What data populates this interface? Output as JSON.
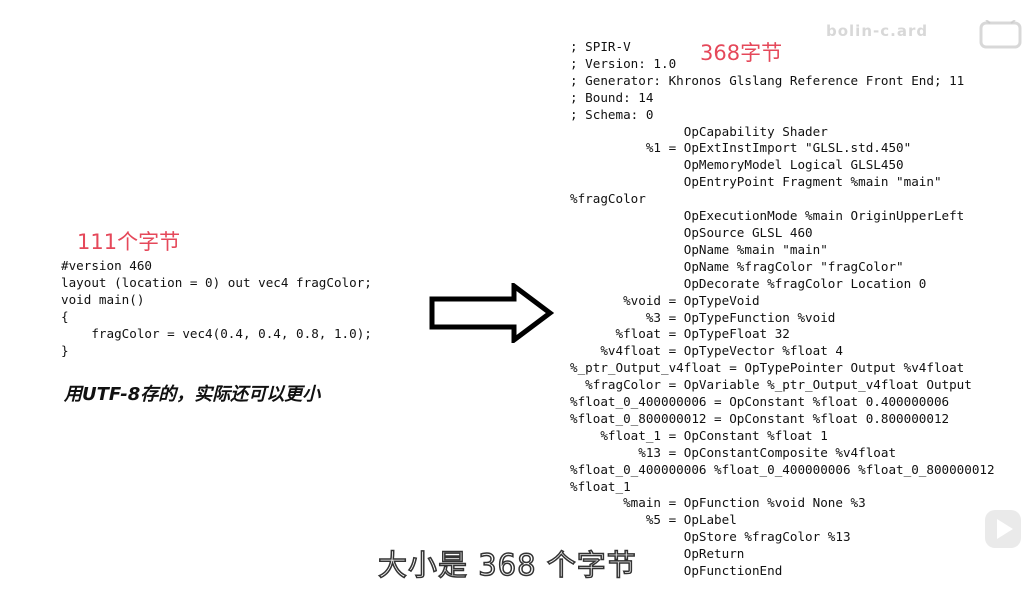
{
  "left": {
    "size_label": "111个字节",
    "code": "#version 460\nlayout (location = 0) out vec4 fragColor;\nvoid main()\n{\n    fragColor = vec4(0.4, 0.4, 0.8, 1.0);\n}",
    "note": "用UTF-8存的，实际还可以更小"
  },
  "right": {
    "size_label": "368字节",
    "code": "; SPIR-V\n; Version: 1.0\n; Generator: Khronos Glslang Reference Front End; 11\n; Bound: 14\n; Schema: 0\n               OpCapability Shader\n          %1 = OpExtInstImport \"GLSL.std.450\"\n               OpMemoryModel Logical GLSL450\n               OpEntryPoint Fragment %main \"main\"\n%fragColor\n               OpExecutionMode %main OriginUpperLeft\n               OpSource GLSL 460\n               OpName %main \"main\"\n               OpName %fragColor \"fragColor\"\n               OpDecorate %fragColor Location 0\n       %void = OpTypeVoid\n          %3 = OpTypeFunction %void\n      %float = OpTypeFloat 32\n    %v4float = OpTypeVector %float 4\n%_ptr_Output_v4float = OpTypePointer Output %v4float\n  %fragColor = OpVariable %_ptr_Output_v4float Output\n%float_0_400000006 = OpConstant %float 0.400000006\n%float_0_800000012 = OpConstant %float 0.800000012\n    %float_1 = OpConstant %float 1\n         %13 = OpConstantComposite %v4float\n%float_0_400000006 %float_0_400000006 %float_0_800000012\n%float_1\n       %main = OpFunction %void None %3\n          %5 = OpLabel\n               OpStore %fragColor %13\n               OpReturn\n               OpFunctionEnd"
  },
  "subtitle": "大小是  368  个字节",
  "watermark": "bolin-c.ard",
  "icons": [
    "right-arrow-icon",
    "bilibili-logo-icon",
    "play-icon"
  ],
  "colors": {
    "accent_red": "#e5485a",
    "text": "#111111",
    "background": "#ffffff"
  }
}
